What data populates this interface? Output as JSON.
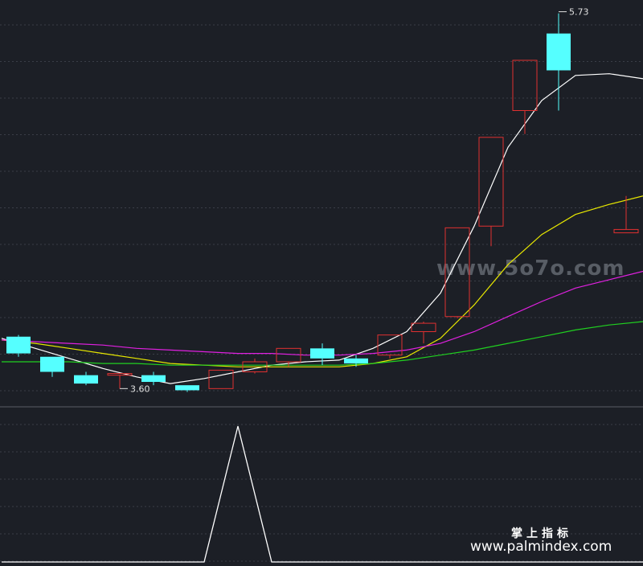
{
  "chart_data": [
    {
      "type": "candlestick",
      "panel": "price",
      "ylim": [
        3.4,
        5.8
      ],
      "candles": [
        {
          "open": 3.79,
          "close": 3.69,
          "high": 3.8,
          "low": 3.67
        },
        {
          "open": 3.67,
          "close": 3.58,
          "high": 3.67,
          "low": 3.55
        },
        {
          "open": 3.56,
          "close": 3.51,
          "high": 3.58,
          "low": 3.5
        },
        {
          "open": 3.56,
          "close": 3.57,
          "high": 3.57,
          "low": 3.48
        },
        {
          "open": 3.56,
          "close": 3.52,
          "high": 3.58,
          "low": 3.5
        },
        {
          "open": 3.5,
          "close": 3.47,
          "high": 3.5,
          "low": 3.46
        },
        {
          "open": 3.48,
          "close": 3.59,
          "high": 3.59,
          "low": 3.48
        },
        {
          "open": 3.58,
          "close": 3.64,
          "high": 3.66,
          "low": 3.57
        },
        {
          "open": 3.64,
          "close": 3.72,
          "high": 3.72,
          "low": 3.61
        },
        {
          "open": 3.72,
          "close": 3.66,
          "high": 3.75,
          "low": 3.62
        },
        {
          "open": 3.66,
          "close": 3.63,
          "high": 3.68,
          "low": 3.61
        },
        {
          "open": 3.68,
          "close": 3.8,
          "high": 3.8,
          "low": 3.66
        },
        {
          "open": 3.82,
          "close": 3.87,
          "high": 3.88,
          "low": 3.75
        },
        {
          "open": 3.91,
          "close": 4.44,
          "high": 4.44,
          "low": 3.9
        },
        {
          "open": 4.45,
          "close": 4.98,
          "high": 4.98,
          "low": 4.33
        },
        {
          "open": 5.14,
          "close": 5.44,
          "high": 5.44,
          "low": 5.0
        },
        {
          "open": 5.6,
          "close": 5.38,
          "high": 5.72,
          "low": 5.14
        },
        {
          "open": null,
          "close": null,
          "high": null,
          "low": null
        },
        {
          "open": 4.41,
          "close": 4.43,
          "high": 4.63,
          "low": 4.41
        }
      ],
      "annotations": [
        {
          "text": "5.73",
          "index": 16,
          "value": 5.73
        },
        {
          "text": "3.60",
          "index": 3,
          "value": 3.48
        }
      ],
      "series": [
        {
          "color": "#ffffff",
          "values": [
            3.78,
            3.72,
            3.66,
            3.6,
            3.55,
            3.51,
            3.54,
            3.58,
            3.62,
            3.64,
            3.65,
            3.72,
            3.82,
            4.05,
            4.45,
            4.92,
            5.2,
            5.35,
            5.36,
            5.33
          ]
        },
        {
          "color": "#e8e800",
          "values": [
            3.77,
            3.75,
            3.72,
            3.69,
            3.66,
            3.63,
            3.62,
            3.61,
            3.61,
            3.61,
            3.61,
            3.63,
            3.67,
            3.78,
            3.98,
            4.22,
            4.4,
            4.52,
            4.58,
            4.63
          ]
        },
        {
          "color": "#e020e0",
          "values": [
            3.77,
            3.76,
            3.75,
            3.74,
            3.72,
            3.71,
            3.7,
            3.69,
            3.69,
            3.68,
            3.68,
            3.69,
            3.71,
            3.75,
            3.82,
            3.91,
            4.0,
            4.08,
            4.13,
            4.18
          ]
        },
        {
          "color": "#20d020",
          "values": [
            3.64,
            3.64,
            3.64,
            3.63,
            3.63,
            3.62,
            3.62,
            3.62,
            3.62,
            3.62,
            3.62,
            3.63,
            3.65,
            3.68,
            3.71,
            3.75,
            3.79,
            3.83,
            3.86,
            3.88
          ]
        }
      ]
    },
    {
      "type": "line",
      "panel": "indicator",
      "ylim": [
        0,
        1
      ],
      "series": [
        {
          "color": "#ffffff",
          "values": [
            0,
            0,
            0,
            0,
            0,
            0,
            0,
            1,
            0,
            0,
            0,
            0,
            0,
            0,
            0,
            0,
            0,
            0,
            0,
            0
          ]
        }
      ]
    }
  ],
  "watermark": "www.5o7o.com",
  "brand": {
    "name": "掌上指标",
    "url": "www.palmindex.com"
  },
  "colors": {
    "up": "#e03030",
    "down": "#55ffff",
    "background": "#1c1f26",
    "grid": "#3a3e47"
  }
}
